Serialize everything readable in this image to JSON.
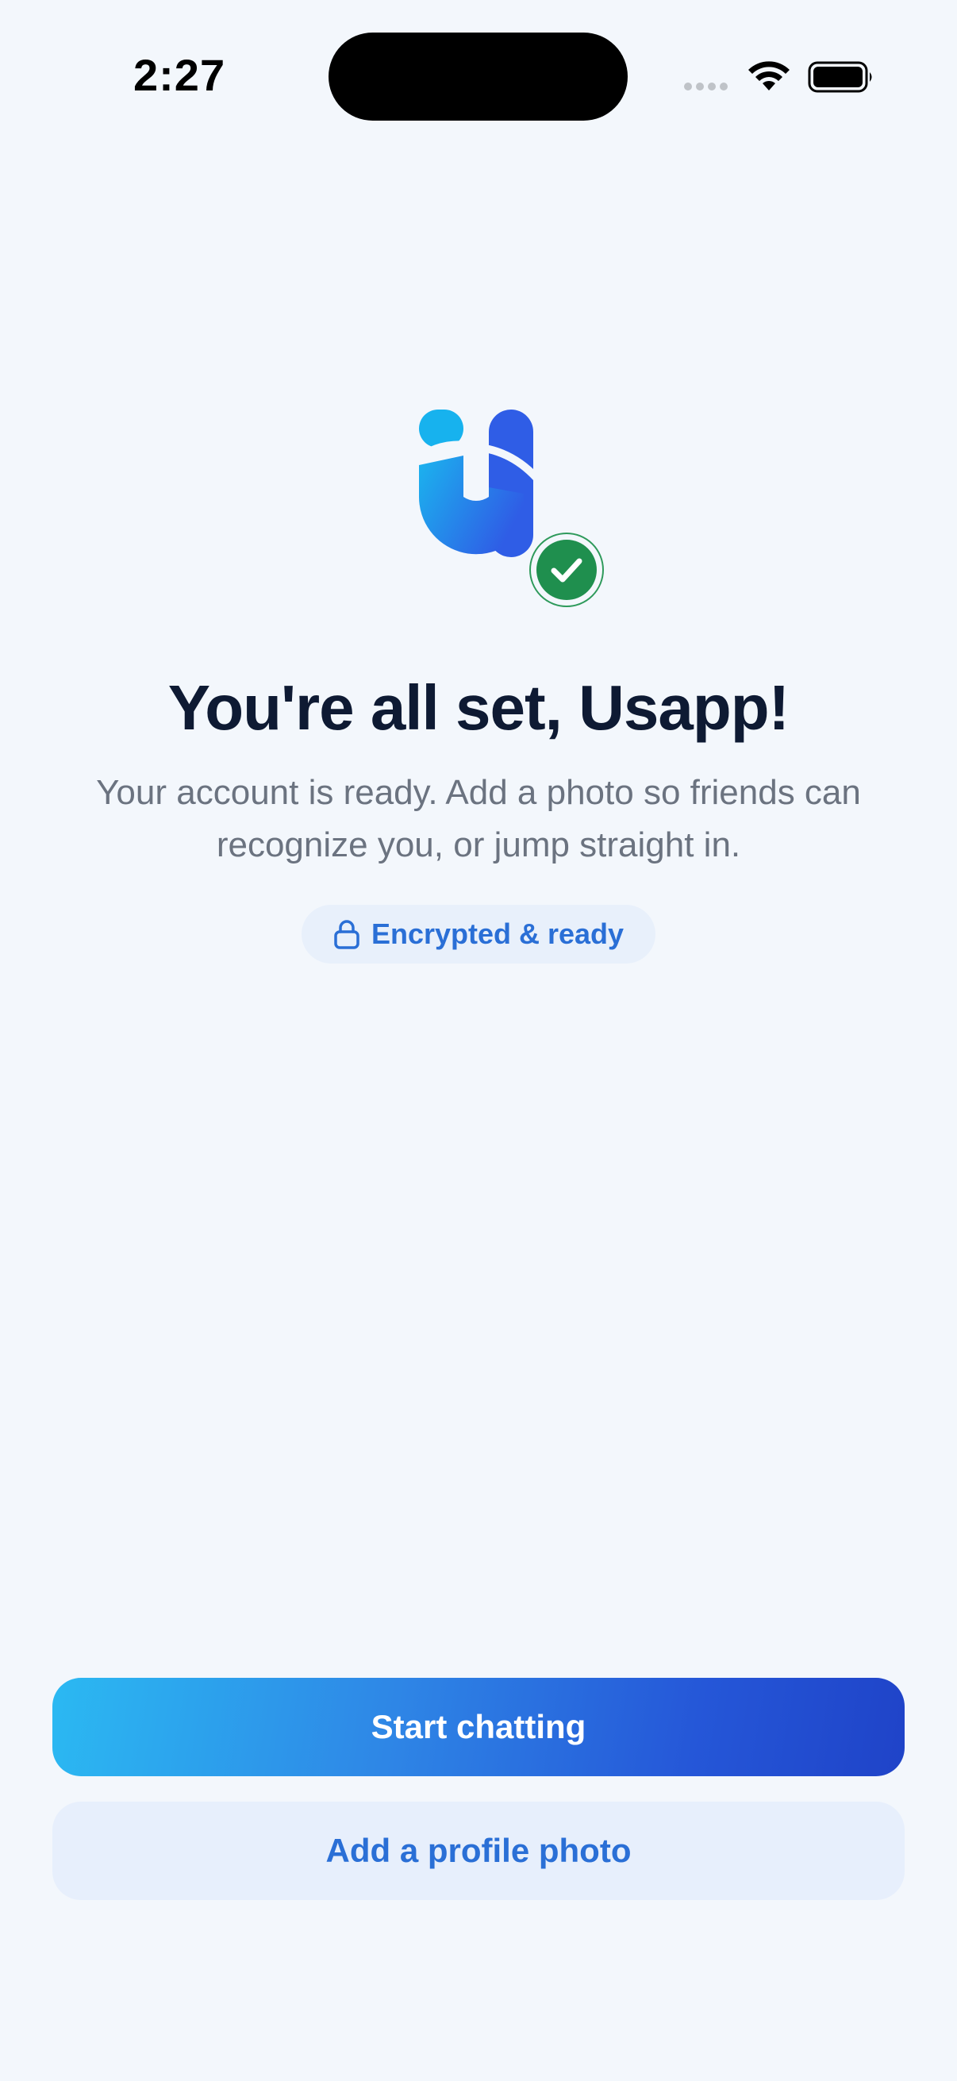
{
  "status_bar": {
    "time": "2:27",
    "icons": [
      "cellular-signal-icon",
      "wifi-icon",
      "battery-icon"
    ]
  },
  "logo": {
    "icon": "usapp-logo-icon",
    "badge_icon": "checkmark-icon",
    "colors": {
      "logo_light": "#1bb4ee",
      "logo_dark": "#2f5de6",
      "badge": "#1f8f4e"
    }
  },
  "main": {
    "title": "You're all set, Usapp!",
    "subtitle_line1": "Your account is ready. Add a photo so friends can",
    "subtitle_line2": "recognize you, or jump straight in.",
    "pill": {
      "icon": "lock-icon",
      "label": "Encrypted & ready"
    }
  },
  "actions": {
    "primary_label": "Start chatting",
    "secondary_label": "Add a profile photo"
  },
  "colors": {
    "background": "#f3f7fc",
    "title": "#0e1a33",
    "subtitle": "#6b7380",
    "accent": "#2a6fd6"
  }
}
